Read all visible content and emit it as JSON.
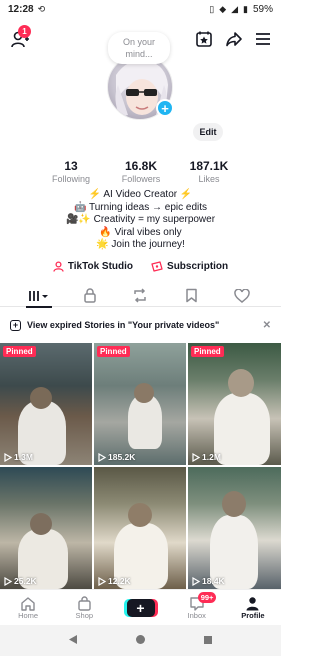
{
  "status_bar": {
    "time": "12:28",
    "battery": "59%"
  },
  "profile": {
    "note_bubble": "On your mind...",
    "edit_label": "Edit"
  },
  "stats": [
    {
      "value": "13",
      "label": "Following"
    },
    {
      "value": "16.8K",
      "label": "Followers"
    },
    {
      "value": "187.1K",
      "label": "Likes"
    }
  ],
  "bio": [
    "⚡ AI Video Creator ⚡",
    "🤖 Turning ideas → epic edits",
    "🎥✨ Creativity = my superpower",
    "🔥 Viral vibes only",
    "🌟 Join the journey!"
  ],
  "links": {
    "tiktok_studio": "TikTok Studio",
    "subscription": "Subscription"
  },
  "notice": {
    "text": "View expired Stories in \"Your private videos\""
  },
  "videos": [
    {
      "pinned": "Pinned",
      "views": "1.3M"
    },
    {
      "pinned": "Pinned",
      "views": "185.2K"
    },
    {
      "pinned": "Pinned",
      "views": "1.2M"
    },
    {
      "pinned": "",
      "views": "25.2K"
    },
    {
      "pinned": "",
      "views": "12.2K"
    },
    {
      "pinned": "",
      "views": "18.4K"
    }
  ],
  "nav": {
    "home": "Home",
    "shop": "Shop",
    "inbox": "Inbox",
    "inbox_badge": "99+",
    "profile": "Profile"
  },
  "notification_badge": "1",
  "colors": {
    "accent": "#fe2c55",
    "avatar_plus": "#20b5f2"
  }
}
